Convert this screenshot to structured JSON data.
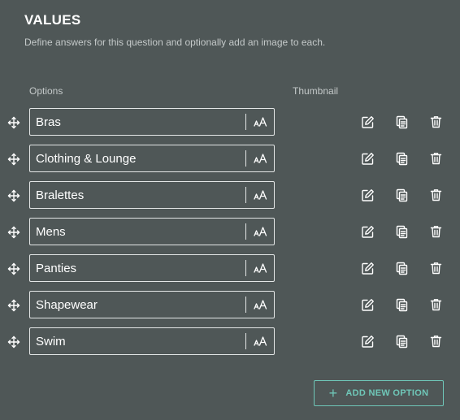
{
  "section": {
    "title": "VALUES",
    "description": "Define answers for this question and optionally add an image to each."
  },
  "columns": {
    "options": "Options",
    "thumbnail": "Thumbnail"
  },
  "options": [
    {
      "value": "Bras"
    },
    {
      "value": "Clothing & Lounge"
    },
    {
      "value": "Bralettes"
    },
    {
      "value": "Mens"
    },
    {
      "value": "Panties"
    },
    {
      "value": "Shapewear"
    },
    {
      "value": "Swim"
    }
  ],
  "add_button": {
    "label": "ADD NEW OPTION",
    "icon": "plus-icon"
  },
  "icons": {
    "drag": "drag-handle-icon",
    "text_format": "text-size-icon",
    "edit": "edit-icon",
    "copy": "copy-icon",
    "delete": "trash-icon"
  },
  "colors": {
    "background": "#4f5757",
    "accent": "#6fc7b8",
    "text": "#ffffff",
    "muted": "#c4c9c9"
  }
}
